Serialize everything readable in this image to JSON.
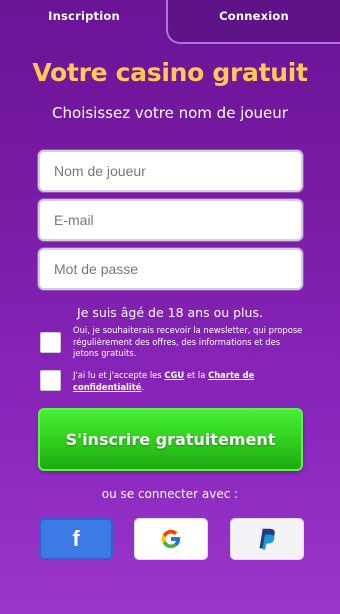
{
  "tabs": {
    "signup_label": "Inscription",
    "login_label": "Connexion"
  },
  "header": {
    "title": "Votre casino gratuit",
    "subtitle": "Choisissez votre nom de joueur"
  },
  "form": {
    "username_placeholder": "Nom de joueur",
    "email_placeholder": "E-mail",
    "password_placeholder": "Mot de passe",
    "age_notice": "Je suis âgé de 18 ans ou plus.",
    "newsletter_text": "Oui, je souhaiterais recevoir la newsletter, qui propose régulièrement des offres, des informations et des jetons gratuits.",
    "terms_prefix": "J'ai lu et j'accepte les ",
    "terms_cgu": "CGU",
    "terms_middle": " et la ",
    "terms_privacy": "Charte de confidentialité",
    "terms_suffix": ".",
    "submit_label": "S'inscrire gratuitement"
  },
  "social": {
    "heading": "ou se connecter avec :",
    "providers": [
      {
        "name": "facebook",
        "icon": "facebook-icon",
        "color": "#3c7be6"
      },
      {
        "name": "google",
        "icon": "google-icon",
        "color": "#ffffff"
      },
      {
        "name": "paypal",
        "icon": "paypal-icon",
        "color": "#f3f3f5"
      }
    ]
  },
  "colors": {
    "title": "#ffc857",
    "cta": "#33d421",
    "background_top": "#6a1496",
    "background_bottom": "#9a36cc"
  }
}
